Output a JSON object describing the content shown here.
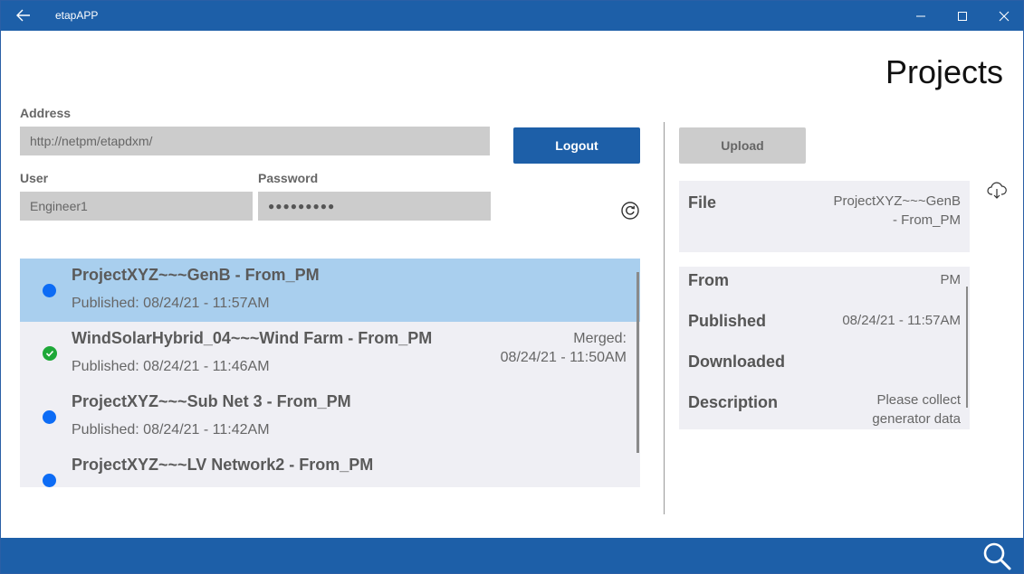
{
  "window": {
    "title": "etapAPP",
    "icons": {
      "back": "back-arrow-icon",
      "minimize": "minimize-icon",
      "maximize": "maximize-icon",
      "close": "close-icon"
    }
  },
  "page": {
    "title": "Projects"
  },
  "login": {
    "address_label": "Address",
    "address_value": "http://netpm/etapdxm/",
    "user_label": "User",
    "user_value": "Engineer1",
    "password_label": "Password",
    "password_value": "●●●●●●●●●",
    "logout_label": "Logout",
    "refresh_icon": "refresh-icon"
  },
  "projects": [
    {
      "name": "ProjectXYZ~~~GenB - From_PM",
      "published": "Published: 08/24/21 - 11:57AM",
      "status": "new",
      "merged_label": "",
      "merged_date": ""
    },
    {
      "name": "WindSolarHybrid_04~~~Wind Farm - From_PM",
      "published": "Published: 08/24/21 - 11:46AM",
      "status": "merged",
      "merged_label": "Merged:",
      "merged_date": "08/24/21 - 11:50AM"
    },
    {
      "name": "ProjectXYZ~~~Sub Net 3 - From_PM",
      "published": "Published: 08/24/21 - 11:42AM",
      "status": "new",
      "merged_label": "",
      "merged_date": ""
    },
    {
      "name": "ProjectXYZ~~~LV Network2 - From_PM",
      "published": "",
      "status": "new",
      "merged_label": "",
      "merged_date": ""
    }
  ],
  "details": {
    "upload_label": "Upload",
    "download_icon": "cloud-download-icon",
    "file_label": "File",
    "file_value_1": "ProjectXYZ~~~GenB",
    "file_value_2": "- From_PM",
    "from_label": "From",
    "from_value": "PM",
    "published_label": "Published",
    "published_value": "08/24/21 - 11:57AM",
    "downloaded_label": "Downloaded",
    "downloaded_value": "",
    "description_label": "Description",
    "description_value_1": "Please collect",
    "description_value_2": "generator data"
  },
  "footer": {
    "search_icon": "search-icon"
  },
  "colors": {
    "accent": "#1d5fa8",
    "selected": "#a9cfee",
    "status_new": "#0d6cf5",
    "status_merged": "#1ea838",
    "panel": "#efeff4"
  }
}
